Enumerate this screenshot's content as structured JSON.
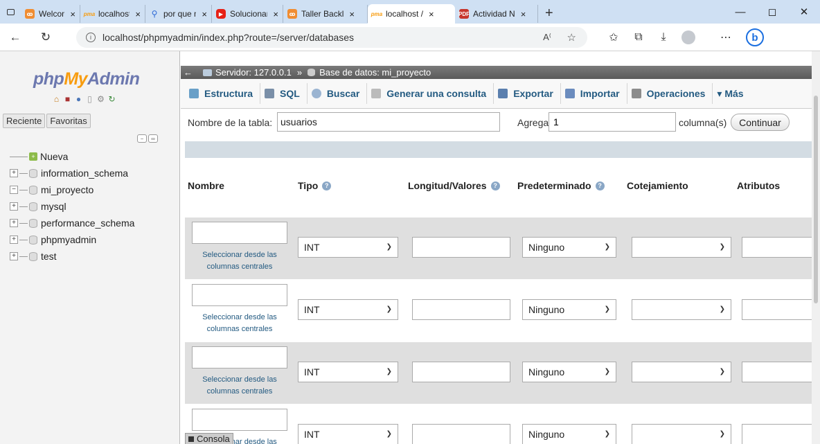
{
  "browser": {
    "tabs": [
      {
        "label": "Welcome t",
        "favicon": "o-icon"
      },
      {
        "label": "localhost /",
        "favicon": "pma-icon"
      },
      {
        "label": "por que m",
        "favicon": "search-icon"
      },
      {
        "label": "Solucionan",
        "favicon": "youtube-icon"
      },
      {
        "label": "Taller Backl",
        "favicon": "o-icon"
      },
      {
        "label": "localhost /",
        "favicon": "pma-icon",
        "active": true
      },
      {
        "label": "Actividad N",
        "favicon": "pdf-icon"
      }
    ],
    "close_glyph": "×",
    "new_tab_glyph": "+",
    "url": "localhost/phpmyadmin/index.php?route=/server/databases"
  },
  "nav": {
    "logo_php": "php",
    "logo_my": "My",
    "logo_admin": "Admin",
    "tabs": [
      "Reciente",
      "Favoritas"
    ],
    "tree": [
      {
        "label": "Nueva",
        "type": "new"
      },
      {
        "label": "information_schema",
        "type": "db",
        "expand": "+"
      },
      {
        "label": "mi_proyecto",
        "type": "db",
        "expand": "−"
      },
      {
        "label": "mysql",
        "type": "db",
        "expand": "+"
      },
      {
        "label": "performance_schema",
        "type": "db",
        "expand": "+"
      },
      {
        "label": "phpmyadmin",
        "type": "db",
        "expand": "+"
      },
      {
        "label": "test",
        "type": "db",
        "expand": "+"
      }
    ]
  },
  "breadcrumb": {
    "server": "Servidor: 127.0.0.1",
    "separator": "»",
    "database": "Base de datos: mi_proyecto"
  },
  "menu": [
    {
      "label": "Estructura",
      "color": "#6aa0c8"
    },
    {
      "label": "SQL",
      "color": "#7a8fa8"
    },
    {
      "label": "Buscar",
      "color": "#9bb4d1"
    },
    {
      "label": "Generar una consulta",
      "color": "#bbbbbb"
    },
    {
      "label": "Exportar",
      "color": "#5b7fae"
    },
    {
      "label": "Importar",
      "color": "#6b8cbe"
    },
    {
      "label": "Operaciones",
      "color": "#8c8c8c"
    },
    {
      "label": "▾ Más",
      "color": "transparent"
    }
  ],
  "form": {
    "table_name_label": "Nombre de la tabla:",
    "table_name_value": "usuarios",
    "add_label": "Agregar",
    "add_value": "1",
    "columns_label": "columna(s)",
    "continue_label": "Continuar"
  },
  "columns": {
    "name": "Nombre",
    "type": "Tipo",
    "length": "Longitud/Valores",
    "default": "Predeterminado",
    "collation": "Cotejamiento",
    "attributes": "Atributos"
  },
  "rows": [
    {
      "type": "INT",
      "default": "Ninguno",
      "central_link": "Seleccionar desde las columnas centrales"
    },
    {
      "type": "INT",
      "default": "Ninguno",
      "central_link": "Seleccionar desde las columnas centrales"
    },
    {
      "type": "INT",
      "default": "Ninguno",
      "central_link": "Seleccionar desde las columnas centrales"
    },
    {
      "type": "INT",
      "default": "Ninguno",
      "central_link": "Seleccionar desde las columnas centrales"
    }
  ],
  "console_label": "Consola"
}
